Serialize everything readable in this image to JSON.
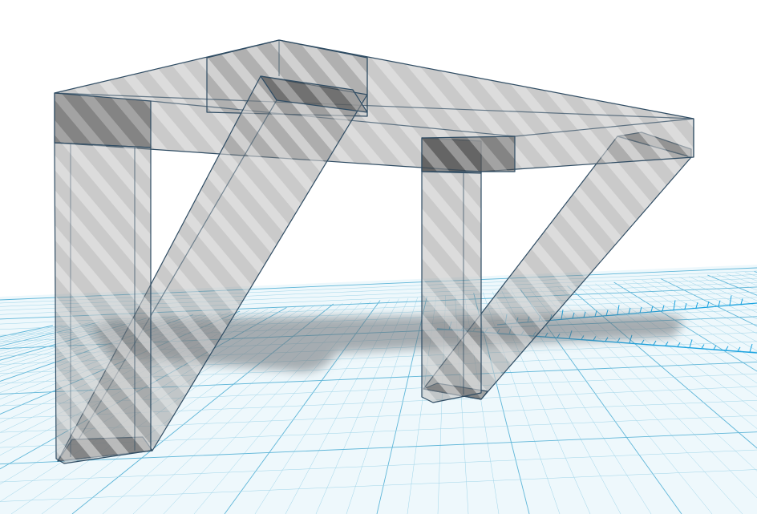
{
  "workplane": {
    "grid_color": "#9fd4e8",
    "major_grid_color": "#5fb6d8",
    "ruler_color": "#1aa3e0",
    "ground_tint": "#eaf6fb"
  },
  "model": {
    "parts": [
      "left-leg",
      "right-leg",
      "left-brace",
      "right-brace",
      "tabletop",
      "hidden-stripe-pattern"
    ],
    "fill_color": "#7d7d7d",
    "fill_opacity": 0.45,
    "stripe_color": "#d4d4d4",
    "edge_color": "#2f4c63",
    "shadow_color": "#6a6f73"
  }
}
